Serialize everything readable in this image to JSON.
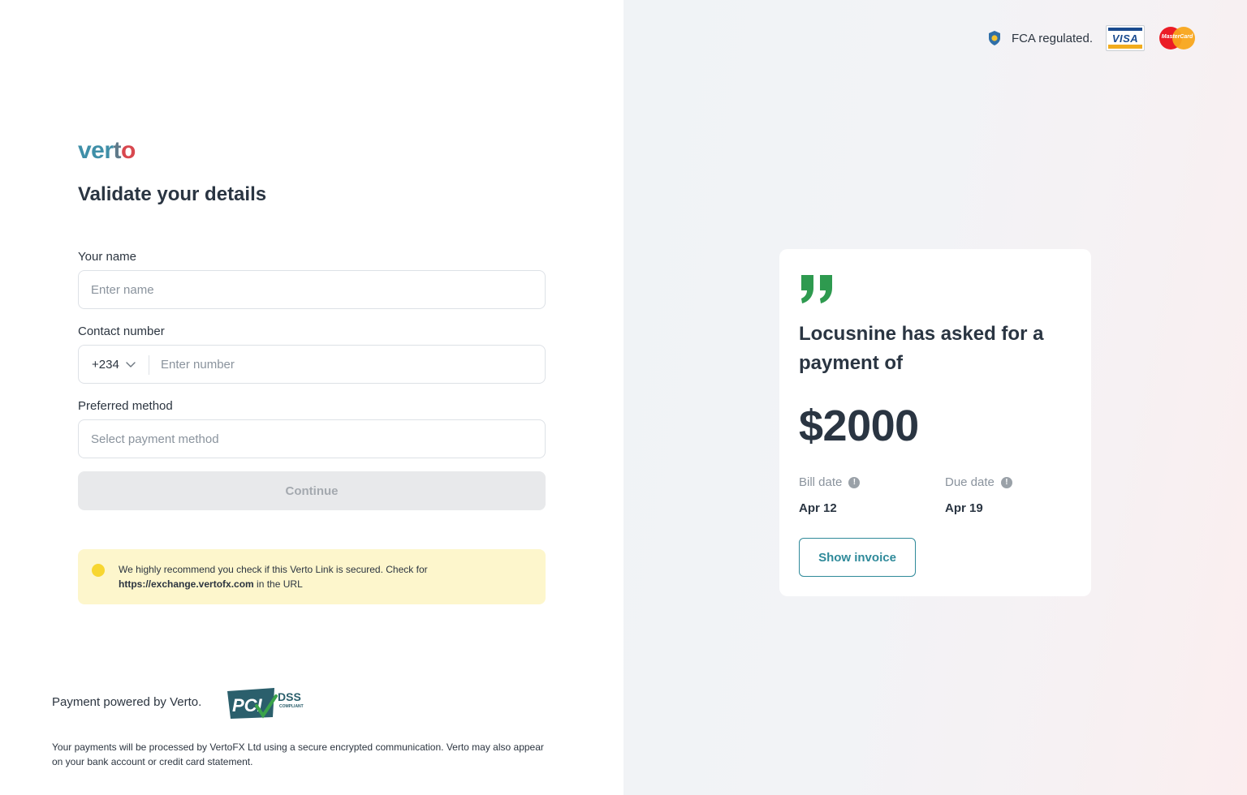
{
  "brand": {
    "logo_part1": "ver",
    "logo_part2": "t",
    "logo_part3": "o",
    "colors": {
      "teal": "#3f8fa8",
      "slate": "#5f7a8a",
      "red": "#d8484f",
      "accent_green": "#2e9a4f",
      "button_teal": "#2f8a9a"
    }
  },
  "form": {
    "title": "Validate your details",
    "name_label": "Your name",
    "name_placeholder": "Enter name",
    "name_value": "",
    "contact_label": "Contact number",
    "country_code": "+234",
    "number_placeholder": "Enter number",
    "number_value": "",
    "method_label": "Preferred method",
    "method_placeholder": "Select payment method",
    "continue_label": "Continue"
  },
  "notice": {
    "text_before": "We highly recommend you check if this Verto Link is secured. Check for ",
    "url": "https://exchange.vertofx.com",
    "text_after": " in the URL"
  },
  "footer": {
    "powered": "Payment powered by Verto.",
    "pci_text": "PCI",
    "dss_text": "DSS",
    "compliant_text": "COMPLIANT",
    "disclaimer": "Your payments will be processed by VertoFX Ltd using a secure encrypted communication. Verto may also appear on your bank account or credit card statement."
  },
  "badges": {
    "fca": "FCA regulated.",
    "visa": "VISA",
    "mastercard": "MasterCard"
  },
  "card": {
    "headline": "Locusnine has asked for a payment of",
    "amount": "$2000",
    "bill_label": "Bill date",
    "bill_value": "Apr 12",
    "due_label": "Due date",
    "due_value": "Apr 19",
    "show_invoice": "Show invoice"
  }
}
